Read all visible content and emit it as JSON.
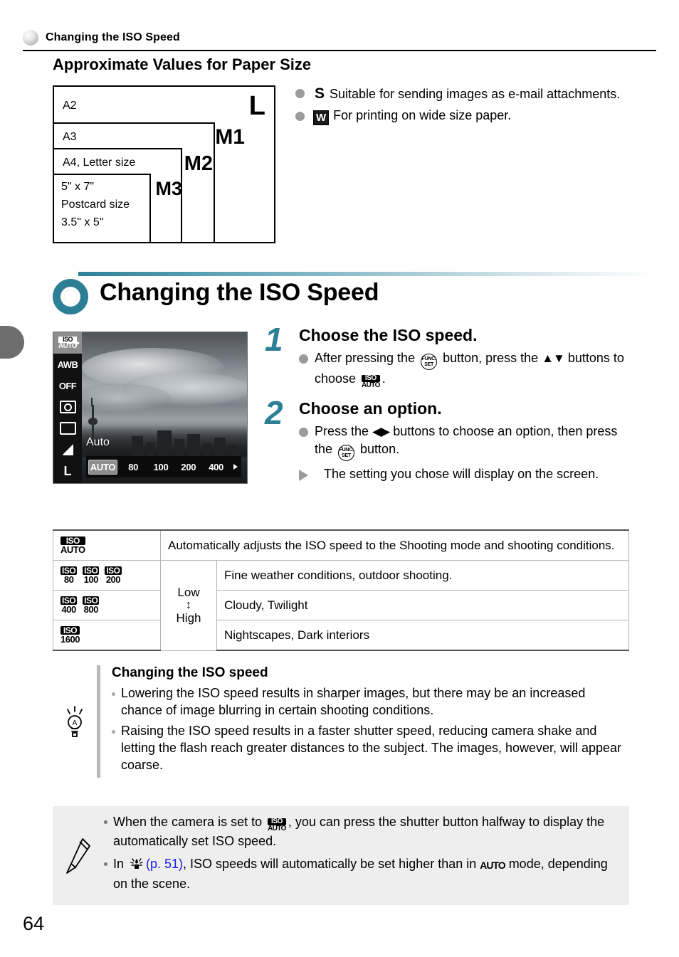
{
  "running_header": {
    "title": "Changing the ISO Speed",
    "dot_icon": "sphere-bullet-icon"
  },
  "paper_section": {
    "heading": "Approximate Values for Paper Size",
    "boxes": [
      {
        "label": "L",
        "text": "A2"
      },
      {
        "label": "M1",
        "text": "A3"
      },
      {
        "label": "M2",
        "text": "A4, Letter size"
      },
      {
        "label": "M3",
        "text_lines": [
          "5\" x 7\"",
          "Postcard size",
          "3.5\" x 5\""
        ]
      }
    ],
    "bullets": [
      {
        "glyph": "S",
        "text": "Suitable for sending images as e-mail attachments."
      },
      {
        "glyph": "W",
        "text": "For printing on wide size paper."
      }
    ]
  },
  "main": {
    "title": "Changing the ISO Speed",
    "ring_icon": "section-ring-icon",
    "accent_color": "#2d7f96"
  },
  "lcd": {
    "sidebar": [
      {
        "name": "iso-auto",
        "top": "ISO",
        "bottom": "AUTO",
        "selected": true
      },
      {
        "name": "white-balance",
        "label": "AWB"
      },
      {
        "name": "flash-off",
        "label": "OFF"
      },
      {
        "name": "metering"
      },
      {
        "name": "drive-mode"
      },
      {
        "name": "image-quality"
      },
      {
        "name": "image-size",
        "label": "L"
      }
    ],
    "mode_label": "Auto",
    "iso_options": [
      "AUTO",
      "80",
      "100",
      "200",
      "400"
    ],
    "selected_iso": "AUTO"
  },
  "steps": [
    {
      "number": "1",
      "heading": "Choose the ISO speed.",
      "lines": [
        {
          "marker": "dot",
          "pre": "After pressing the ",
          "btn": {
            "top": "FUNC.",
            "bottom": "SET"
          },
          "mid": " button, press the ",
          "arrows": "▲▼",
          "post": " buttons to choose ",
          "iso": {
            "top": "ISO",
            "bottom": "AUTO"
          },
          "tail": "."
        }
      ]
    },
    {
      "number": "2",
      "heading": "Choose an option.",
      "lines": [
        {
          "marker": "dot",
          "pre": "Press the ",
          "arrows": "◀▶",
          "post": " buttons to choose an option, then press the ",
          "btn": {
            "top": "FUNC.",
            "bottom": "SET"
          },
          "tail": " button."
        },
        {
          "marker": "triangle",
          "text": "The setting you chose will display on the screen."
        }
      ]
    }
  ],
  "iso_table": {
    "rows": [
      {
        "icons": [
          {
            "top": "ISO",
            "bottom": "AUTO"
          }
        ],
        "level": "",
        "description": "Automatically adjusts the ISO speed to the Shooting mode and shooting conditions."
      },
      {
        "icons": [
          {
            "top": "ISO",
            "bottom": "80"
          },
          {
            "top": "ISO",
            "bottom": "100"
          },
          {
            "top": "ISO",
            "bottom": "200"
          }
        ],
        "level": "Low",
        "description": "Fine weather conditions, outdoor shooting."
      },
      {
        "icons": [
          {
            "top": "ISO",
            "bottom": "400"
          },
          {
            "top": "ISO",
            "bottom": "800"
          }
        ],
        "level": "↕",
        "description": "Cloudy, Twilight"
      },
      {
        "icons": [
          {
            "top": "ISO",
            "bottom": "1600"
          }
        ],
        "level": "High",
        "description": "Nightscapes, Dark interiors"
      }
    ]
  },
  "tips": {
    "icon": "lightbulb-icon",
    "title": "Changing the ISO speed",
    "items": [
      "Lowering the ISO speed results in sharper images, but there may be an increased chance of image blurring in certain shooting conditions.",
      "Raising the ISO speed results in a faster shutter speed, reducing camera shake and letting the flash reach greater distances to the subject. The images, however, will appear coarse."
    ]
  },
  "note": {
    "icon": "pencil-icon",
    "items": [
      {
        "pre": "When the camera is set to ",
        "iso": {
          "top": "ISO",
          "bottom": "AUTO"
        },
        "post": ", you can press the shutter button halfway to display the automatically set ISO speed."
      },
      {
        "pre": "In ",
        "scene_icon": "low-light-icon",
        "link": "(p. 51)",
        "post": ", ISO speeds will automatically be set higher than in ",
        "auto": "AUTO",
        "tail": " mode, depending on the scene."
      }
    ]
  },
  "page_number": "64"
}
